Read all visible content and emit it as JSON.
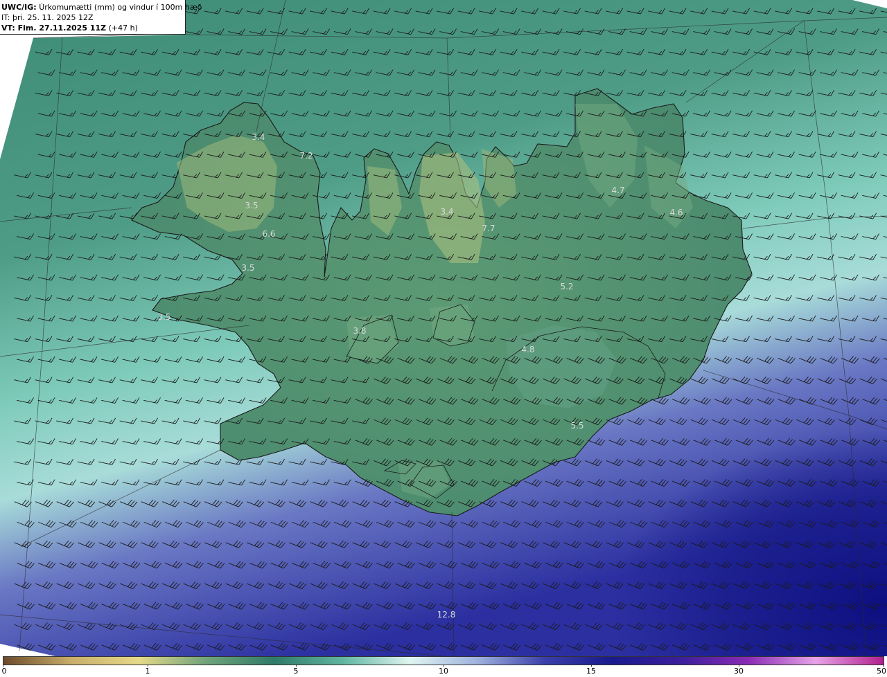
{
  "title": {
    "line1_bold": "UWC/IG:",
    "line1_rest": "Úrkomumætti (mm) og vindur í 100m hæð",
    "line2": "IT: þri. 25. 11. 2025 12Z",
    "line3_bold": "VT: Fim. 27.11.2025 11Z",
    "line3_rest": "(+47 h)"
  },
  "map_labels": [
    {
      "text": "3.4",
      "id": "westfjords-north"
    },
    {
      "text": "7.2",
      "id": "westfjords-east"
    },
    {
      "text": "3.5",
      "id": "westfjords-central"
    },
    {
      "text": "6.6",
      "id": "westfjords-south"
    },
    {
      "text": "3.5",
      "id": "breidafjordur"
    },
    {
      "text": "3.5",
      "id": "snaefellsnes"
    },
    {
      "text": "3.8",
      "id": "west-interior"
    },
    {
      "text": "3.4",
      "id": "trollaskagi"
    },
    {
      "text": "7.7",
      "id": "eyjafjordur"
    },
    {
      "text": "4.7",
      "id": "northeast"
    },
    {
      "text": "4.6",
      "id": "east-fjords"
    },
    {
      "text": "5.2",
      "id": "highlands"
    },
    {
      "text": "4.8",
      "id": "vatnajokull"
    },
    {
      "text": "5.5",
      "id": "southeast-coast"
    },
    {
      "text": "12.8",
      "id": "offshore-south"
    }
  ],
  "colorbar": {
    "ticks": [
      "0",
      "1",
      "5",
      "10",
      "15",
      "30",
      "50"
    ],
    "colors": [
      "#6b4a2b",
      "#c9ae6a",
      "#e6d98a",
      "#6fa37a",
      "#2f7a68",
      "#5fb5a0",
      "#dff5f0",
      "#9fb3df",
      "#3b3fa8",
      "#1a1a8c",
      "#3b1f9a",
      "#8a2bb5",
      "#e7a3e7",
      "#b0208f"
    ]
  }
}
